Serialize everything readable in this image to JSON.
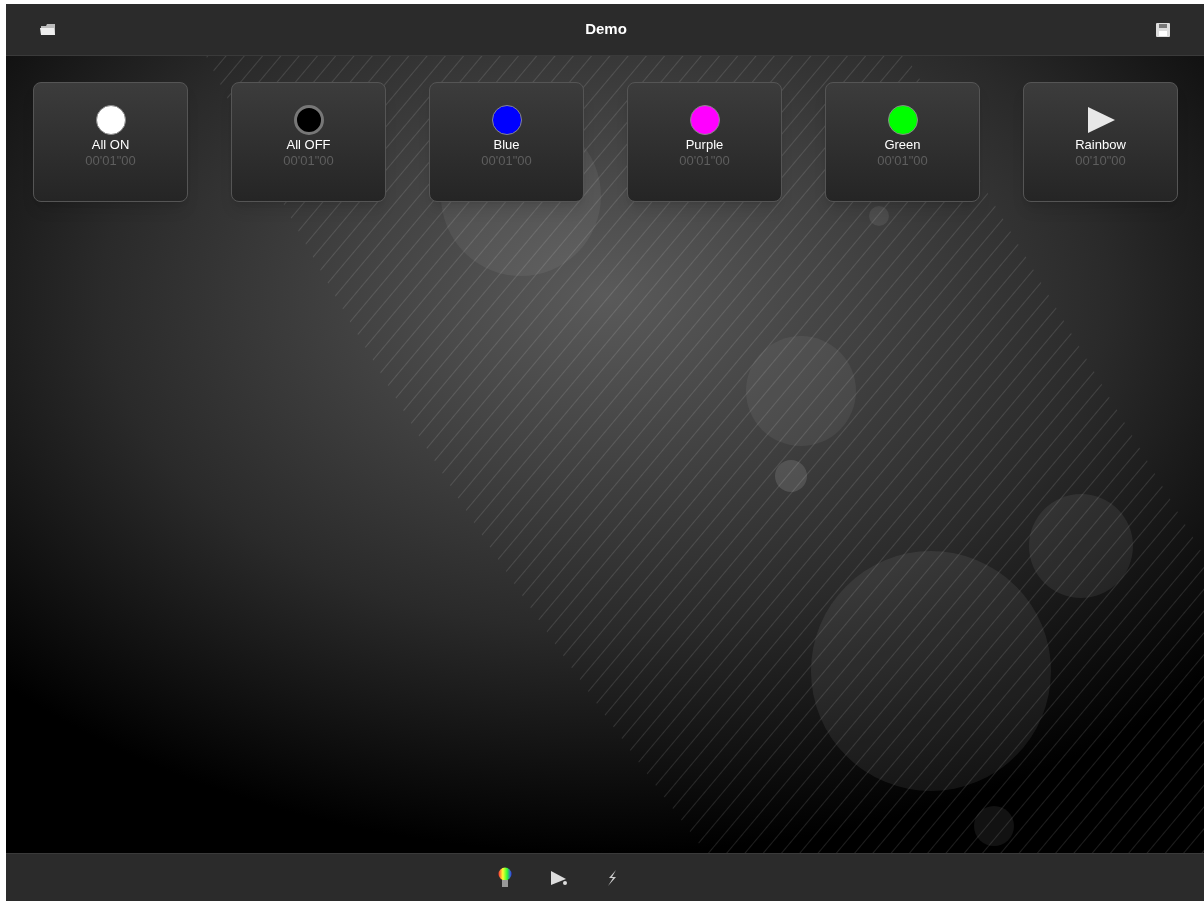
{
  "window": {
    "title": "Demo"
  },
  "scenes": [
    {
      "kind": "light",
      "color": "#ffffff",
      "label": "All ON",
      "duration": "00'01\"00"
    },
    {
      "kind": "off",
      "label": "All OFF",
      "duration": "00'01\"00"
    },
    {
      "kind": "light",
      "color": "#0000ff",
      "label": "Blue",
      "duration": "00'01\"00"
    },
    {
      "kind": "light",
      "color": "#ff00ff",
      "label": "Purple",
      "duration": "00'01\"00"
    },
    {
      "kind": "light",
      "color": "#00ff00",
      "label": "Green",
      "duration": "00'01\"00"
    },
    {
      "kind": "play",
      "label": "Rainbow",
      "duration": "00'10\"00"
    }
  ]
}
